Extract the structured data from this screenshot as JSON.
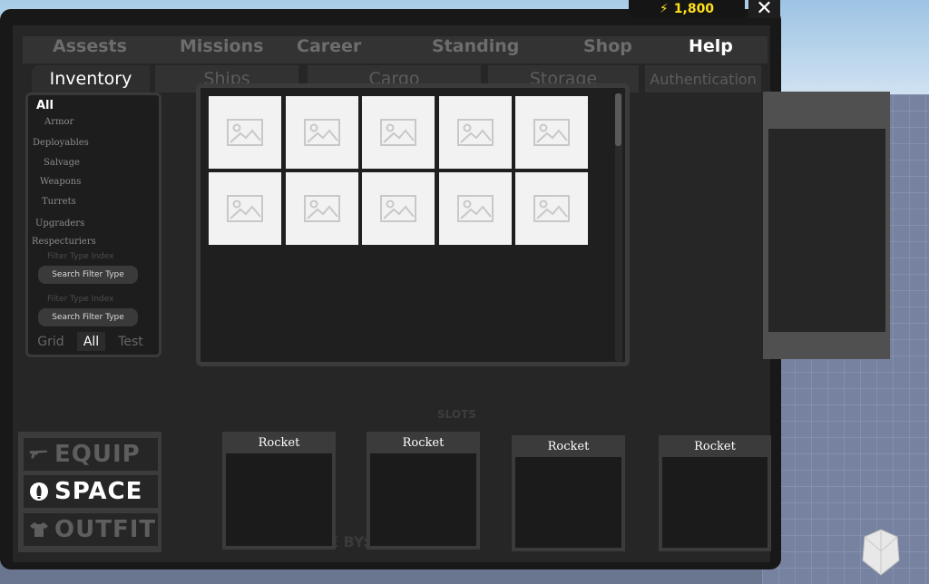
{
  "currency": {
    "amount": "1,800",
    "icon": "bolt-icon",
    "color": "#ffe01a"
  },
  "close_label": "✕",
  "tabs": [
    {
      "label": "Assests",
      "active": false
    },
    {
      "label": "Missions",
      "active": false
    },
    {
      "label": "Career",
      "active": false
    },
    {
      "label": "Standing",
      "active": false
    },
    {
      "label": "Shop",
      "active": false
    },
    {
      "label": "Help",
      "active": true
    }
  ],
  "subtabs": [
    {
      "label": "Inventory",
      "active": true
    },
    {
      "label": "Ships",
      "active": false
    },
    {
      "label": "Cargo",
      "active": false
    },
    {
      "label": "Storage",
      "active": false
    },
    {
      "label": "Authentication",
      "active": false
    }
  ],
  "filter": {
    "categories": [
      "All",
      "Armor",
      "Deployables",
      "Salvage",
      "Weapons",
      "Turrets",
      "Upgraders",
      "Respecturiers"
    ],
    "filter_type_index_1": "Filter Type Index",
    "search_button_1": "Search Filter Type",
    "filter_type_index_2": "Filter Type Index",
    "search_button_2": "Search Filter Type",
    "modes": [
      {
        "label": "Grid",
        "active": false
      },
      {
        "label": "All",
        "active": true
      },
      {
        "label": "Test",
        "active": false
      }
    ]
  },
  "grid": {
    "items": 10,
    "placeholder_icon": "image-placeholder-icon"
  },
  "slots_title": "SLOTS",
  "made_by": "E BY:",
  "sidenav": [
    {
      "label": "EQUIP",
      "icon": "gun-icon",
      "active": false
    },
    {
      "label": "SPACE",
      "icon": "rocket-icon",
      "active": true
    },
    {
      "label": "OUTFIT",
      "icon": "shirt-icon",
      "active": false
    }
  ],
  "slots": [
    {
      "label": "Rocket"
    },
    {
      "label": "Rocket"
    },
    {
      "label": "Rocket"
    },
    {
      "label": "Rocket"
    }
  ]
}
